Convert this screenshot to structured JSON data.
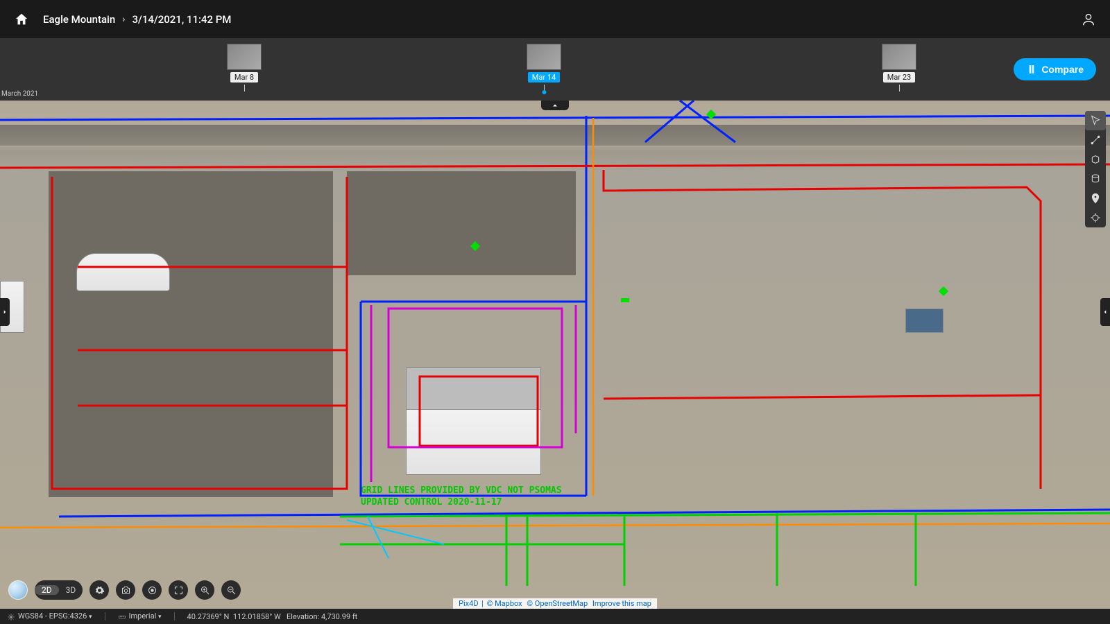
{
  "header": {
    "project": "Eagle Mountain",
    "datetime": "3/14/2021, 11:42 PM"
  },
  "timeline": {
    "month_label": "March 2021",
    "items": [
      {
        "label": "Mar 8",
        "pos_pct": 22,
        "active": false
      },
      {
        "label": "Mar 14",
        "pos_pct": 49,
        "active": true
      },
      {
        "label": "Mar 23",
        "pos_pct": 81,
        "active": false
      }
    ],
    "compare_label": "Compare"
  },
  "view_toggle": {
    "d2": "2D",
    "d3": "3D",
    "active": "2D"
  },
  "tools": {
    "select": "select",
    "measure_line": "measure-line",
    "measure_area": "measure-area",
    "volume": "volume",
    "marker": "marker",
    "gps": "gps"
  },
  "status": {
    "crs": "WGS84 - EPSG:4326",
    "units": "Imperial",
    "lat": "40.27369° N",
    "lon": "112.01858° W",
    "elev_label": "Elevation:",
    "elev_value": "4,730.99 ft"
  },
  "attribution": {
    "brand": "Pix4D",
    "mapbox": "© Mapbox",
    "osm": "© OpenStreetMap",
    "improve": "Improve this map"
  },
  "cad_text": {
    "line1": "GRID LINES PROVIDED BY VDC NOT PSOMAS",
    "line2": "UPDATED CONTROL 2020-11-17"
  }
}
